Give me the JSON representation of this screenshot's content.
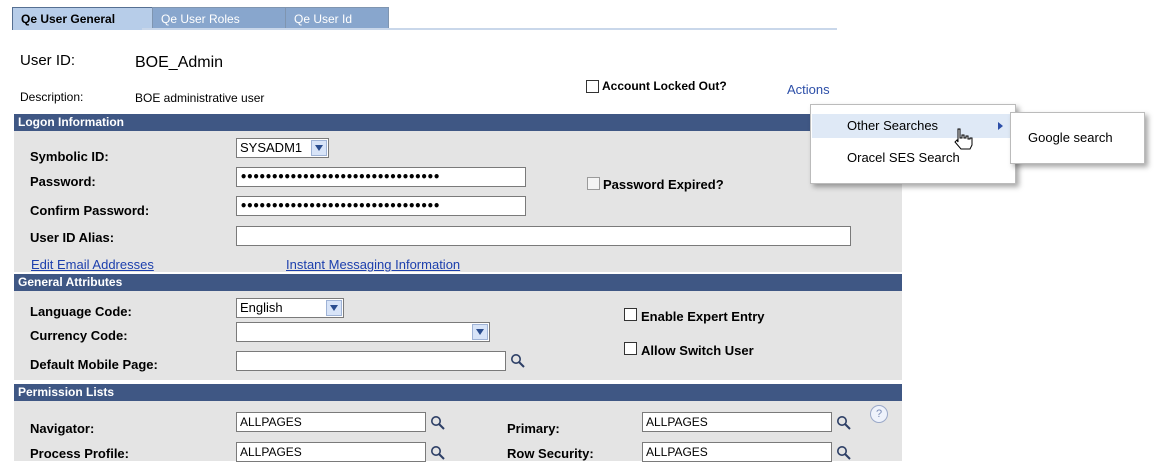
{
  "tabs": [
    {
      "label": "Qe User General"
    },
    {
      "label": "Qe User Roles"
    },
    {
      "label": "Qe User Id"
    }
  ],
  "header": {
    "user_id_label": "User ID:",
    "user_id_value": "BOE_Admin",
    "description_label": "Description:",
    "description_value": "BOE administrative user",
    "account_locked_label": "Account Locked Out?",
    "actions_link": "Actions"
  },
  "logon": {
    "title": "Logon Information",
    "symbolic_id_label": "Symbolic ID:",
    "symbolic_id_value": "SYSADM1",
    "password_label": "Password:",
    "password_value": "••••••••••••••••••••••••••••••••",
    "confirm_password_label": "Confirm Password:",
    "confirm_password_value": "••••••••••••••••••••••••••••••••",
    "password_expired_label": "Password Expired?",
    "alias_label": "User ID Alias:",
    "alias_value": "",
    "edit_email_link": "Edit Email Addresses",
    "instant_messaging_link": "Instant Messaging Information"
  },
  "general": {
    "title": "General Attributes",
    "language_label": "Language Code:",
    "language_value": "English",
    "currency_label": "Currency Code:",
    "currency_value": "",
    "mobile_label": "Default Mobile Page:",
    "mobile_value": "",
    "expert_entry_label": "Enable Expert Entry",
    "switch_user_label": "Allow Switch User"
  },
  "permissions": {
    "title": "Permission Lists",
    "navigator_label": "Navigator:",
    "navigator_value": "ALLPAGES",
    "primary_label": "Primary:",
    "primary_value": "ALLPAGES",
    "process_profile_label": "Process Profile:",
    "process_profile_value": "ALLPAGES",
    "row_security_label": "Row Security:",
    "row_security_value": "ALLPAGES",
    "help_glyph": "?"
  },
  "actions_menu": {
    "items": [
      {
        "label": "Other Searches"
      },
      {
        "label": "Oracel SES Search"
      }
    ],
    "submenu": [
      {
        "label": "Google search"
      }
    ]
  },
  "colors": {
    "section_bg": "#3f5784",
    "active_tab": "#b7cde9",
    "inactive_tab": "#88a6cd",
    "link": "#1c3fad",
    "menu_highlight": "#dfe9f6"
  }
}
